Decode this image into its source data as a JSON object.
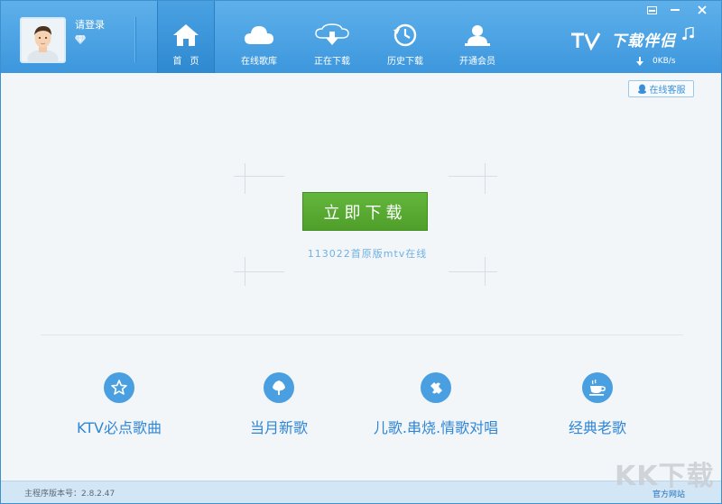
{
  "user": {
    "login_label": "请登录"
  },
  "nav": [
    {
      "label": "首页",
      "icon": "home-icon"
    },
    {
      "label": "在线歌库",
      "icon": "cloud-icon"
    },
    {
      "label": "正在下载",
      "icon": "cloud-download-icon"
    },
    {
      "label": "历史下载",
      "icon": "history-icon"
    },
    {
      "label": "开通会员",
      "icon": "member-icon"
    }
  ],
  "logo": {
    "text": "下载伴侣"
  },
  "speed": {
    "value": "0KB/s"
  },
  "service": {
    "label": "在线客服"
  },
  "main": {
    "download_button": "立即下载",
    "subtitle": "113022首原版mtv在线"
  },
  "categories": [
    {
      "label": "KTV必点歌曲",
      "icon": "star-icon"
    },
    {
      "label": "当月新歌",
      "icon": "leaf-icon"
    },
    {
      "label": "儿歌.串烧.情歌对唱",
      "icon": "puzzle-icon"
    },
    {
      "label": "经典老歌",
      "icon": "teacup-icon"
    }
  ],
  "footer": {
    "version": "主程序版本号：2.8.2.47",
    "official_site": "官方网站"
  },
  "watermark": {
    "text": "KK下载"
  },
  "colors": {
    "accent": "#3d97dd",
    "button_green": "#5aad34",
    "text_blue": "#2f86d4"
  }
}
